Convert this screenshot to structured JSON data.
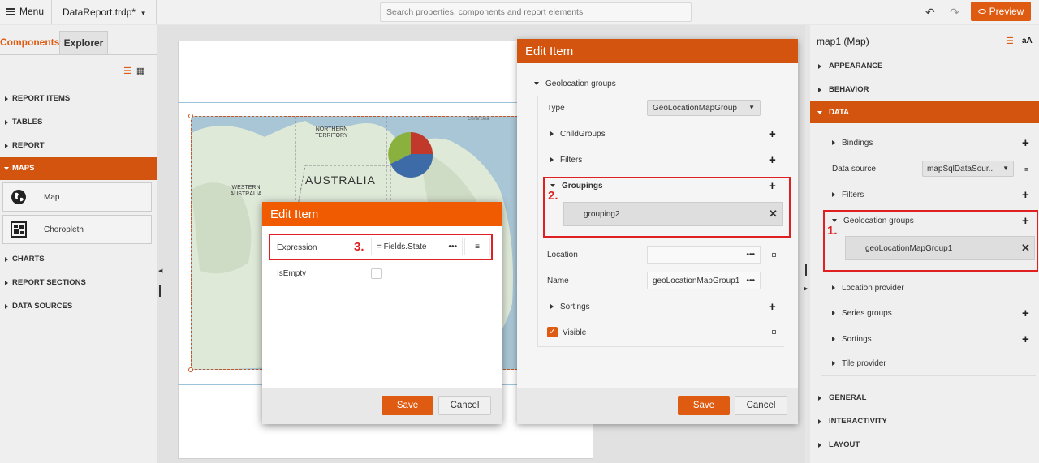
{
  "topbar": {
    "menu_label": "Menu",
    "file_title": "DataReport.trdp*",
    "search_placeholder": "Search properties, components and report elements",
    "preview_label": "Preview"
  },
  "left_panel": {
    "tabs": [
      {
        "label": "Components"
      },
      {
        "label": "Explorer"
      }
    ],
    "sections": [
      {
        "label": "REPORT ITEMS"
      },
      {
        "label": "TABLES"
      },
      {
        "label": "REPORT"
      },
      {
        "label": "MAPS"
      },
      {
        "label": "CHARTS"
      },
      {
        "label": "REPORT SECTIONS"
      },
      {
        "label": "DATA SOURCES"
      }
    ],
    "map_items": [
      {
        "label": "Map",
        "icon": "globe-icon"
      },
      {
        "label": "Choropleth",
        "icon": "choropleth-icon"
      }
    ]
  },
  "map": {
    "labels": {
      "northern_territory": "NORTHERN TERRITORY",
      "australia": "AUSTRALIA",
      "western_australia": "WESTERN AUSTRALIA",
      "coral_sea": "Coral Sea"
    }
  },
  "edit_item_groups": {
    "title": "Edit Item",
    "section": "Geolocation groups",
    "type_label": "Type",
    "type_value": "GeoLocationMapGroup",
    "childgroups_label": "ChildGroups",
    "filters_label": "Filters",
    "groupings_label": "Groupings",
    "grouping_chip": "grouping2",
    "location_label": "Location",
    "name_label": "Name",
    "name_value": "geoLocationMapGroup1",
    "sortings_label": "Sortings",
    "visible_label": "Visible",
    "visible_checked": true,
    "annotation": "2.",
    "save_label": "Save",
    "cancel_label": "Cancel"
  },
  "edit_item_expression": {
    "title": "Edit Item",
    "expression_label": "Expression",
    "expression_value": "= Fields.State",
    "isempty_label": "IsEmpty",
    "isempty_checked": false,
    "annotation": "3.",
    "save_label": "Save",
    "cancel_label": "Cancel"
  },
  "right_panel": {
    "title": "map1 (Map)",
    "font_toggle": "aA",
    "sections_top": [
      {
        "label": "APPEARANCE"
      },
      {
        "label": "BEHAVIOR"
      },
      {
        "label": "DATA"
      }
    ],
    "bindings_label": "Bindings",
    "datasource_label": "Data source",
    "datasource_value": "mapSqlDataSour...",
    "filters_label": "Filters",
    "geogroups_label": "Geolocation groups",
    "geogroup_chip": "geoLocationMapGroup1",
    "annotation": "1.",
    "location_provider_label": "Location provider",
    "series_groups_label": "Series groups",
    "sortings_label": "Sortings",
    "tile_provider_label": "Tile provider",
    "sections_bottom": [
      {
        "label": "GENERAL"
      },
      {
        "label": "INTERACTIVITY"
      },
      {
        "label": "LAYOUT"
      }
    ]
  },
  "colors": {
    "accent": "#e05b12",
    "header": "#d3540f",
    "highlight": "#e02020"
  }
}
